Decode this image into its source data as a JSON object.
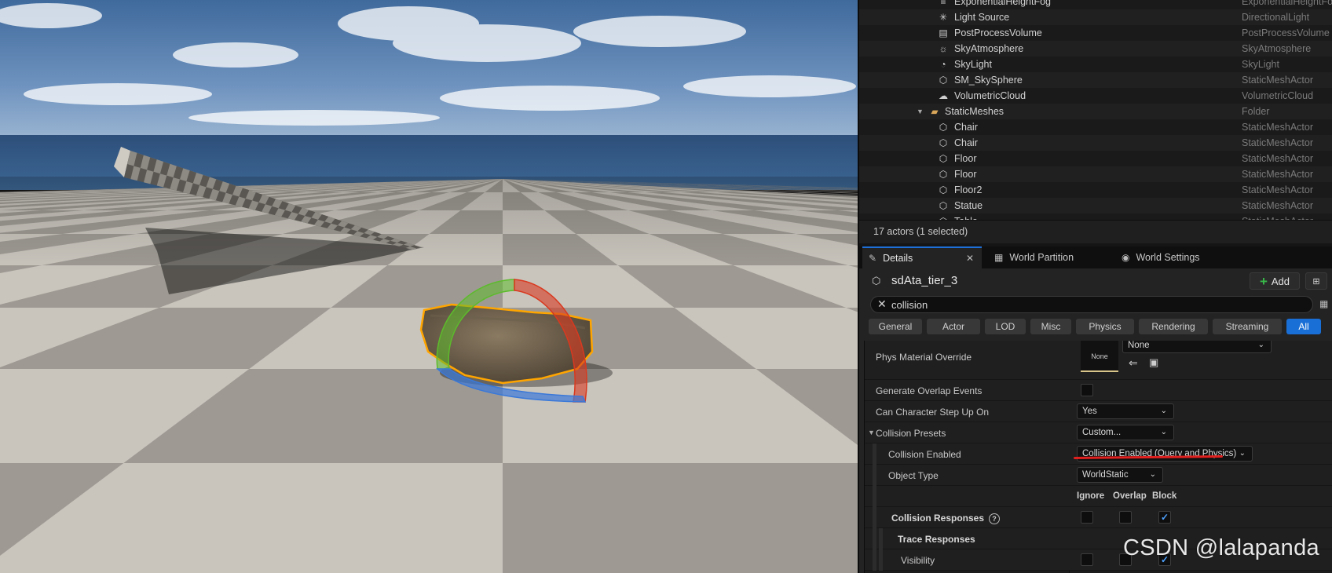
{
  "outliner": {
    "rows": [
      {
        "name": "ExponentialHeightFog",
        "type": "ExponentialHeightFog",
        "icon": "fog-icon"
      },
      {
        "name": "Light Source",
        "type": "DirectionalLight",
        "icon": "directional-light-icon"
      },
      {
        "name": "PostProcessVolume",
        "type": "PostProcessVolume",
        "icon": "post-process-volume-icon"
      },
      {
        "name": "SkyAtmosphere",
        "type": "SkyAtmosphere",
        "icon": "sky-atmosphere-icon"
      },
      {
        "name": "SkyLight",
        "type": "SkyLight",
        "icon": "sky-light-icon"
      },
      {
        "name": "SM_SkySphere",
        "type": "StaticMeshActor",
        "icon": "static-mesh-icon"
      },
      {
        "name": "VolumetricCloud",
        "type": "VolumetricCloud",
        "icon": "volumetric-cloud-icon"
      },
      {
        "name": "StaticMeshes",
        "type": "Folder",
        "icon": "folder-icon"
      },
      {
        "name": "Chair",
        "type": "StaticMeshActor",
        "icon": "static-mesh-icon"
      },
      {
        "name": "Chair",
        "type": "StaticMeshActor",
        "icon": "static-mesh-icon"
      },
      {
        "name": "Floor",
        "type": "StaticMeshActor",
        "icon": "static-mesh-icon"
      },
      {
        "name": "Floor",
        "type": "StaticMeshActor",
        "icon": "static-mesh-icon"
      },
      {
        "name": "Floor2",
        "type": "StaticMeshActor",
        "icon": "static-mesh-icon"
      },
      {
        "name": "Statue",
        "type": "StaticMeshActor",
        "icon": "static-mesh-icon"
      },
      {
        "name": "Table",
        "type": "StaticMeshActor",
        "icon": "static-mesh-icon"
      }
    ],
    "actor_count": "17 actors (1 selected)"
  },
  "tabs": {
    "details": "Details",
    "world_partition": "World Partition",
    "world_settings": "World Settings"
  },
  "details": {
    "actor_name": "sdAta_tier_3",
    "add_label": "Add",
    "search_value": "collision",
    "filters": [
      "General",
      "Actor",
      "LOD",
      "Misc",
      "Physics",
      "Rendering",
      "Streaming",
      "All"
    ],
    "active_filter": "All"
  },
  "properties": {
    "phys_material_override": {
      "label": "Phys Material Override",
      "thumb": "None",
      "value": "None"
    },
    "generate_overlap_events": {
      "label": "Generate Overlap Events",
      "checked": false
    },
    "can_character_step_up_on": {
      "label": "Can Character Step Up On",
      "value": "Yes"
    },
    "collision_presets": {
      "label": "Collision Presets",
      "value": "Custom..."
    },
    "collision_enabled": {
      "label": "Collision Enabled",
      "value": "Collision Enabled (Query and Physics)"
    },
    "object_type": {
      "label": "Object Type",
      "value": "WorldStatic"
    },
    "response_columns": [
      "Ignore",
      "Overlap",
      "Block"
    ],
    "collision_responses": {
      "label": "Collision Responses",
      "block": true
    },
    "trace_responses": {
      "label": "Trace Responses"
    },
    "visibility": {
      "label": "Visibility",
      "block": true
    }
  },
  "watermark": "CSDN @lalapanda",
  "colors": {
    "accent": "#1a6fd6",
    "gizmo_red": "#d9391f",
    "gizmo_green": "#5dbb2c",
    "gizmo_blue": "#3a78d8",
    "selection": "#ffa500"
  }
}
